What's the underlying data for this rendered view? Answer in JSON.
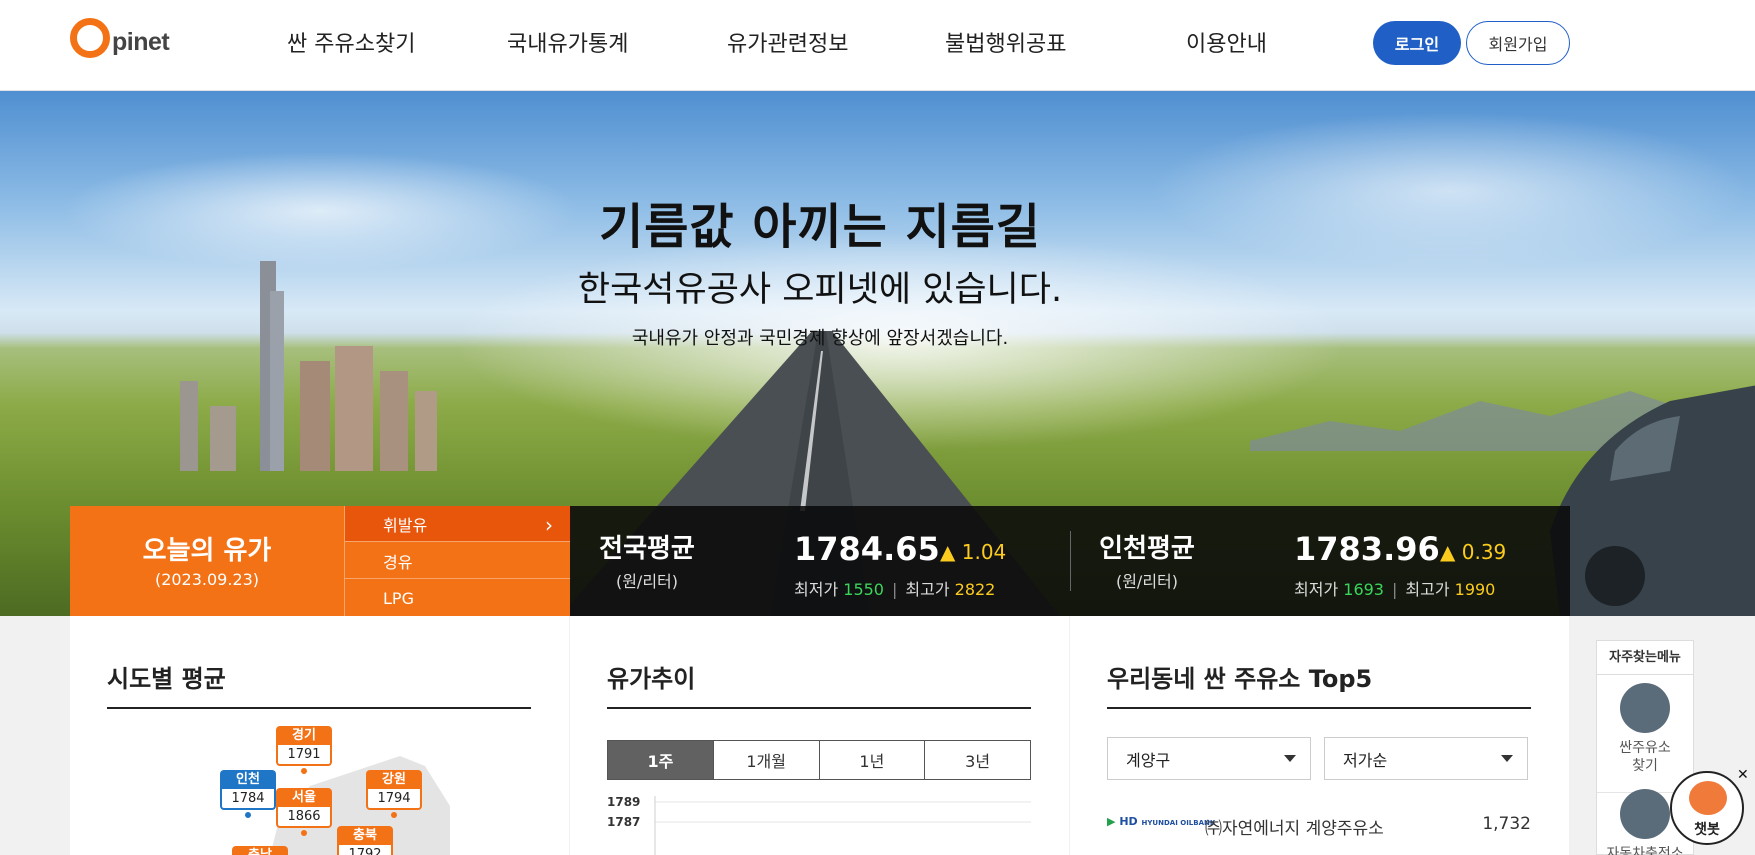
{
  "header": {
    "logo_first": "O",
    "logo_rest": "pinet",
    "nav": [
      "싼 주유소찾기",
      "국내유가통계",
      "유가관련정보",
      "불법행위공표",
      "이용안내"
    ],
    "login": "로그인",
    "join": "회원가입"
  },
  "hero": {
    "title": "기름값 아끼는 지름길",
    "subtitle": "한국석유공사 오피넷에 있습니다.",
    "desc": "국내유가 안정과 국민경제 향상에 앞장서겠습니다."
  },
  "today": {
    "title": "오늘의 유가",
    "date": "(2023.09.23)",
    "fuels": [
      {
        "label": "휘발유",
        "selected": true
      },
      {
        "label": "경유",
        "selected": false
      },
      {
        "label": "LPG",
        "selected": false
      }
    ],
    "chevron": "›"
  },
  "averages": [
    {
      "name": "전국평균",
      "unit": "(원/리터)",
      "price": "1784.65",
      "diff": "▲ 1.04",
      "min_label": "최저가",
      "min": "1550",
      "max_label": "최고가",
      "max": "2822"
    },
    {
      "name": "인천평균",
      "unit": "(원/리터)",
      "price": "1783.96",
      "diff": "▲ 0.39",
      "min_label": "최저가",
      "min": "1693",
      "max_label": "최고가",
      "max": "1990"
    }
  ],
  "regional": {
    "title": "시도별 평균",
    "tags": [
      {
        "name": "경기",
        "value": "1791",
        "color": "orange"
      },
      {
        "name": "인천",
        "value": "1784",
        "color": "blue"
      },
      {
        "name": "서울",
        "value": "1866",
        "color": "orange"
      },
      {
        "name": "강원",
        "value": "1794",
        "color": "orange"
      },
      {
        "name": "충북",
        "value": "1792",
        "color": "orange"
      },
      {
        "name": "충남",
        "value": "",
        "color": "orange"
      }
    ]
  },
  "trend": {
    "title": "유가추이",
    "tabs": [
      {
        "label": "1주",
        "selected": true
      },
      {
        "label": "1개월",
        "selected": false
      },
      {
        "label": "1년",
        "selected": false
      },
      {
        "label": "3년",
        "selected": false
      }
    ],
    "chart_data": {
      "type": "line",
      "y_ticks": [
        "1789",
        "1787"
      ]
    }
  },
  "top5": {
    "title": "우리동네 싼 주유소 Top5",
    "area": "계양구",
    "sort": "저가순",
    "stations": [
      {
        "brand": "HD",
        "brand_sub": "HYUNDAI OILBANK",
        "name": "㈜자연에너지 계양주유소",
        "price": "1,732"
      }
    ]
  },
  "quick": {
    "title": "자주찾는메뉴",
    "items": [
      "싼주유소 찾기",
      "자동차충전소"
    ]
  },
  "chatbot": {
    "label": "챗봇",
    "close": "✕"
  },
  "colors": {
    "brand_orange": "#f47216",
    "brand_blue": "#1f5fc6",
    "min_green": "#3ad65b",
    "max_yellow": "#fbcb1d"
  }
}
